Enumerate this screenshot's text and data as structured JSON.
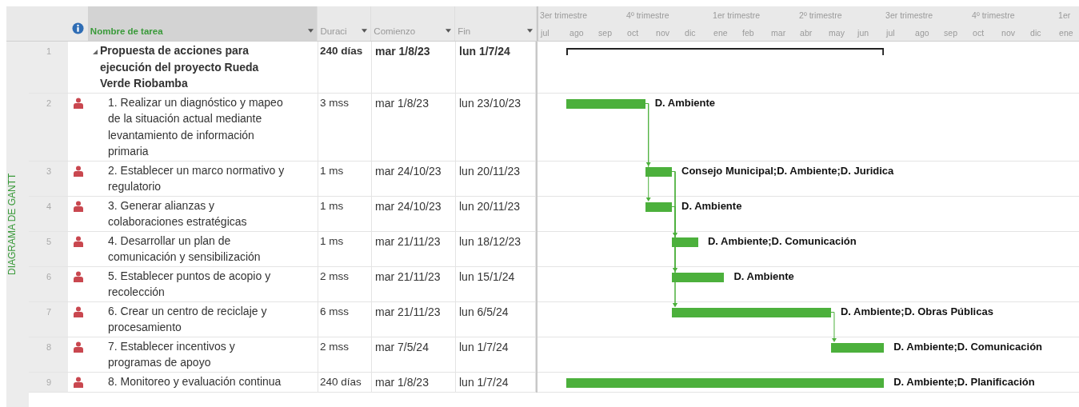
{
  "side_label": "DIAGRAMA DE GANTT",
  "columns": [
    {
      "label": "Nombre de tarea",
      "selected": true
    },
    {
      "label": "Duraci",
      "selected": false
    },
    {
      "label": "Comienzo",
      "selected": false
    },
    {
      "label": "Fin",
      "selected": false
    }
  ],
  "timescale": {
    "quarters": [
      "3er trimestre",
      "4º trimestre",
      "1er trimestre",
      "2º trimestre",
      "3er trimestre",
      "4º trimestre",
      "1er"
    ],
    "months": [
      "jul",
      "ago",
      "sep",
      "oct",
      "nov",
      "dic",
      "ene",
      "feb",
      "mar",
      "abr",
      "may",
      "jun",
      "jul",
      "ago",
      "sep",
      "oct",
      "nov",
      "dic",
      "ene"
    ]
  },
  "tasks": [
    {
      "id": "1",
      "name": "Propuesta de acciones para ejecución del proyecto Rueda Verde Riobamba",
      "duration": "240 días",
      "start": "mar 1/8/23",
      "finish": "lun 1/7/24",
      "summary": true,
      "expanded": true
    },
    {
      "id": "2",
      "resource_assigned": true,
      "name": "1. Realizar un diagnóstico y mapeo de la situación actual mediante levantamiento de información primaria",
      "duration": "3 mss",
      "start": "mar 1/8/23",
      "finish": "lun 23/10/23",
      "summary": false,
      "resources": "D. Ambiente"
    },
    {
      "id": "3",
      "resource_assigned": true,
      "name": "2. Establecer un marco normativo y regulatorio",
      "duration": "1 ms",
      "start": "mar 24/10/23",
      "finish": "lun 20/11/23",
      "summary": false,
      "resources": "Consejo Municipal;D. Ambiente;D. Juridica"
    },
    {
      "id": "4",
      "resource_assigned": true,
      "name": "3. Generar alianzas y colaboraciones estratégicas",
      "duration": "1 ms",
      "start": "mar 24/10/23",
      "finish": "lun 20/11/23",
      "summary": false,
      "resources": "D. Ambiente"
    },
    {
      "id": "5",
      "resource_assigned": true,
      "name": "4. Desarrollar un plan de comunicación y sensibilización",
      "duration": "1 ms",
      "start": "mar 21/11/23",
      "finish": "lun 18/12/23",
      "summary": false,
      "resources": "D. Ambiente;D. Comunicación"
    },
    {
      "id": "6",
      "resource_assigned": true,
      "name": "5. Establecer puntos de acopio y recolección",
      "duration": "2 mss",
      "start": "mar 21/11/23",
      "finish": "lun 15/1/24",
      "summary": false,
      "resources": "D. Ambiente"
    },
    {
      "id": "7",
      "resource_assigned": true,
      "name": "6. Crear un centro de reciclaje y procesamiento",
      "duration": "6 mss",
      "start": "mar 21/11/23",
      "finish": "lun 6/5/24",
      "summary": false,
      "resources": "D. Ambiente;D. Obras Públicas"
    },
    {
      "id": "8",
      "resource_assigned": true,
      "name": "7. Establecer incentivos y programas de apoyo",
      "duration": "2 mss",
      "start": "mar 7/5/24",
      "finish": "lun 1/7/24",
      "summary": false,
      "resources": "D. Ambiente;D. Comunicación"
    },
    {
      "id": "9",
      "resource_assigned": true,
      "name": "8. Monitoreo y evaluación continua",
      "duration": "240 días",
      "start": "mar 1/8/23",
      "finish": "lun 1/7/24",
      "summary": false,
      "resources": "D. Ambiente;D. Planificación"
    }
  ]
}
